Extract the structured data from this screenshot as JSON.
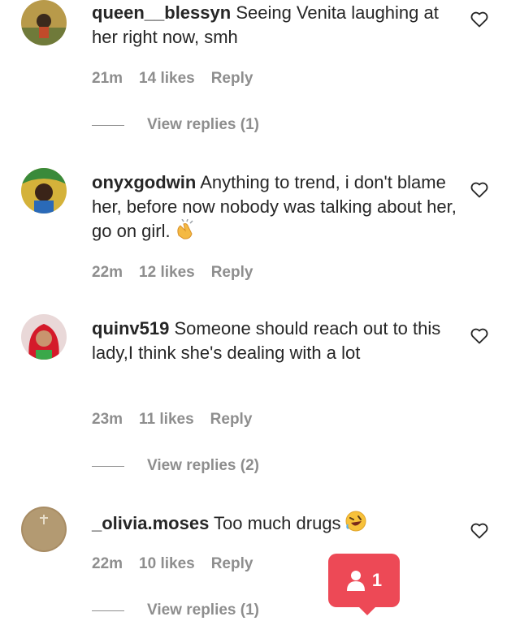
{
  "comments": [
    {
      "username": "queen__blessyn",
      "text": "Seeing Venita laughing at her right now, smh",
      "time": "21m",
      "likes": "14 likes",
      "reply": "Reply",
      "view_replies": "View replies (1)"
    },
    {
      "username": "onyxgodwin",
      "text": "Anything to trend, i don't blame her, before now nobody was talking about her, go on girl.",
      "time": "22m",
      "likes": "12 likes",
      "reply": "Reply",
      "emoji": "clapping-hands"
    },
    {
      "username": "quinv519",
      "text": "Someone should reach out to this lady,I think she's dealing with a lot",
      "time": "23m",
      "likes": "11 likes",
      "reply": "Reply",
      "view_replies": "View replies (2)"
    },
    {
      "username": "_olivia.moses",
      "text": "Too much drugs",
      "time": "22m",
      "likes": "10 likes",
      "reply": "Reply",
      "emoji": "rolling-on-floor-laughing",
      "view_replies": "View replies (1)"
    }
  ],
  "notification": {
    "icon": "person-icon",
    "count": "1",
    "color": "#ed4956"
  },
  "colors": {
    "text": "#262626",
    "muted": "#8e8e8e"
  }
}
